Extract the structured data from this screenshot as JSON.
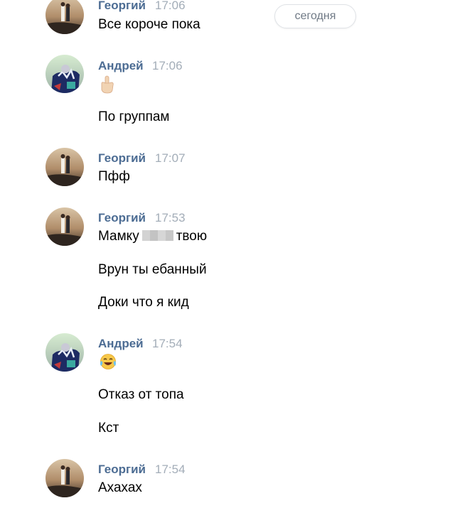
{
  "date_divider": "сегодня",
  "messages": [
    {
      "author": "Георгий",
      "time": "17:06",
      "lines": [
        "Все короче пока"
      ]
    },
    {
      "author": "Андрей",
      "time": "17:06",
      "emoji": "middle-finger-emoji",
      "lines": [
        "По группам"
      ]
    },
    {
      "author": "Георгий",
      "time": "17:07",
      "lines": [
        "Пфф"
      ]
    },
    {
      "author": "Георгий",
      "time": "17:53",
      "lines": [
        "Мамку",
        "твою",
        "Врун ты ебанный",
        "Доки что я кид"
      ]
    },
    {
      "author": "Андрей",
      "time": "17:54",
      "emoji": "tears-of-joy-emoji",
      "lines": [
        "Отказ от топа",
        "Кст"
      ]
    },
    {
      "author": "Георгий",
      "time": "17:54",
      "lines": [
        "Ахахах"
      ]
    }
  ],
  "colors": {
    "author": "#4c6c93",
    "time": "#a3adb8",
    "divider_text": "#6f7985"
  }
}
